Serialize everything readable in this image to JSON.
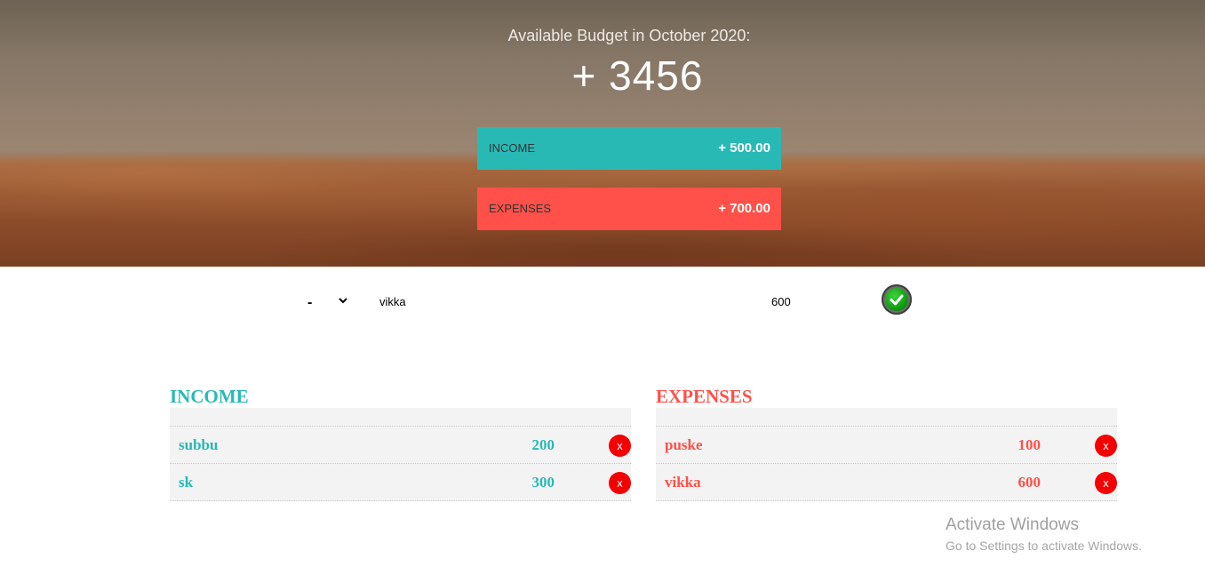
{
  "header": {
    "title": "Available Budget in October 2020:",
    "budget_value": "+ 3456"
  },
  "summary": {
    "income": {
      "label": "Income",
      "value": "+ 500.00"
    },
    "expenses": {
      "label": "Expenses",
      "value": "+ 700.00"
    }
  },
  "add_form": {
    "type_selected": "-",
    "description_value": "vikka",
    "amount_value": "600",
    "submit_icon": "check-circle-icon"
  },
  "income": {
    "title": "Income",
    "items": [
      {
        "name": "subbu",
        "amount": "200",
        "delete_label": "x"
      },
      {
        "name": "sk",
        "amount": "300",
        "delete_label": "x"
      }
    ]
  },
  "expenses": {
    "title": "Expenses",
    "items": [
      {
        "name": "puske",
        "amount": "100",
        "delete_label": "x"
      },
      {
        "name": "vikka",
        "amount": "600",
        "delete_label": "x"
      }
    ]
  },
  "watermark": {
    "line1": "Activate Windows",
    "line2": "Go to Settings to activate Windows."
  },
  "colors": {
    "income": "#28b9b5",
    "expenses": "#ff5049",
    "delete": "#f40000"
  }
}
